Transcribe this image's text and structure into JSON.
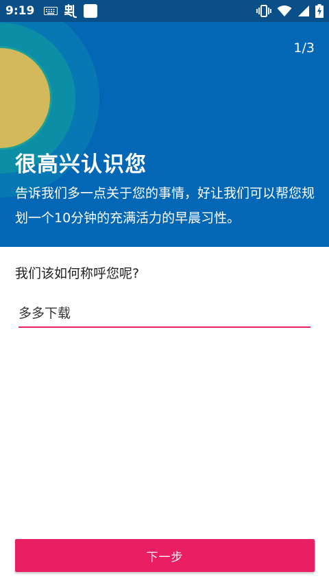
{
  "status_bar": {
    "time": "9:19",
    "icons": [
      "keyboard-icon",
      "app-notification-icon",
      "square-notification-icon",
      "vibrate-icon",
      "wifi-icon",
      "signal-icon",
      "battery-charging-icon"
    ]
  },
  "header": {
    "page_indicator": "1/3",
    "title": "很高兴认识您",
    "description": "告诉我们多一点关于您的事情，好让我们可以帮您规划一个10分钟的充满活力的早晨习性。"
  },
  "form": {
    "question": "我们该如何称呼您呢?",
    "name_value": "多多下载"
  },
  "actions": {
    "next_label": "下一步"
  },
  "colors": {
    "status_bar": "#0a4f87",
    "header_bg": "#0467b6",
    "accent": "#e91e63",
    "sun": "#d4b95c",
    "ring_inner": "#1c9f99",
    "ring_middle": "#0c8fa6",
    "ring_outer": "#0878b4"
  }
}
